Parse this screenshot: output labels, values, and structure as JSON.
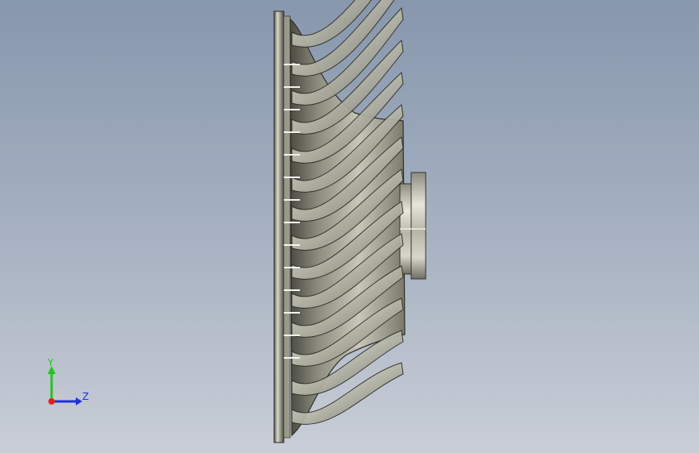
{
  "viewport": {
    "background_top": "#8797ad",
    "background_bottom": "#c9ced7"
  },
  "model": {
    "icon": "impeller-part",
    "metal_light": "#e9e9e0",
    "metal_mid": "#a9a99a",
    "metal_dark": "#3a3a32"
  },
  "triad": {
    "y_label": "Y",
    "z_label": "Z",
    "y_color": "#22c322",
    "z_color": "#1f2ee0",
    "x_color": "#e02020"
  }
}
